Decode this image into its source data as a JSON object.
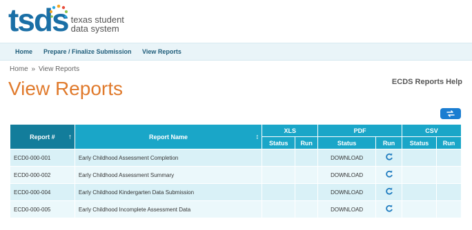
{
  "logo": {
    "main": "tsds",
    "sub_line1": "texas student",
    "sub_line2": "data system"
  },
  "nav": {
    "items": [
      "Home",
      "Prepare / Finalize Submission",
      "View Reports"
    ]
  },
  "breadcrumb": {
    "home": "Home",
    "sep": "»",
    "current": "View Reports"
  },
  "page": {
    "title": "View Reports",
    "help": "ECDS Reports Help"
  },
  "table": {
    "headers": {
      "report_num": "Report #",
      "report_name": "Report Name",
      "xls": "XLS",
      "pdf": "PDF",
      "csv": "CSV",
      "status": "Status",
      "run": "Run"
    },
    "rows": [
      {
        "id": "ECD0-000-001",
        "name": "Early Childhood Assessment Completion",
        "pdf_status": "DOWNLOAD"
      },
      {
        "id": "ECD0-000-002",
        "name": "Early Childhood Assessment Summary",
        "pdf_status": "DOWNLOAD"
      },
      {
        "id": "ECD0-000-004",
        "name": "Early Childhood Kindergarten Data Submission",
        "pdf_status": "DOWNLOAD"
      },
      {
        "id": "ECD0-000-005",
        "name": "Early Childhood Incomplete Assessment Data",
        "pdf_status": "DOWNLOAD"
      }
    ]
  },
  "colors": {
    "accent": "#1aa6c8",
    "title_orange": "#e07a2c",
    "logo_blue": "#1a6fa6",
    "link_blue": "#1e7bbf"
  },
  "icons": {
    "refresh": "refresh-icon",
    "swap": "swap-icon",
    "sort": "sort-icon"
  }
}
